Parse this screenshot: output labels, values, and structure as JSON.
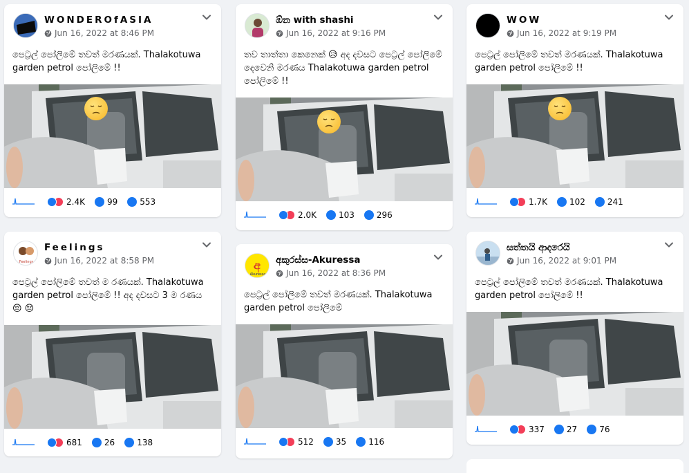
{
  "posts": [
    {
      "page_name": "WONDEROfASIA",
      "date": "Jun 16, 2022 at 8:46 PM",
      "text": "පෙට්‍රල් පෝලිමේ තවත් මරණයක්. Thalakotuwa garden petrol පෝලිමේ !!",
      "reactions": "2.4K",
      "comments": "99",
      "shares": "553",
      "photo_emoji": true
    },
    {
      "page_name": "ඕන with shashi",
      "date": "Jun 16, 2022 at 9:16 PM",
      "text": "තව තාත්තා කෙනෙක් 😥 අද දවසට පෙට්‍රල් පෝලිමේ දෙවෙනි මරණය Thalakotuwa garden petrol පෝලිමේ !!",
      "reactions": "2.0K",
      "comments": "103",
      "shares": "296",
      "photo_emoji": true
    },
    {
      "page_name": "WOW",
      "date": "Jun 16, 2022 at 9:19 PM",
      "text": "පෙට්‍රල් පෝලිමේ තවත් මරණයක්. Thalakotuwa garden petrol පෝලිමේ !!",
      "reactions": "1.7K",
      "comments": "102",
      "shares": "241",
      "photo_emoji": true
    },
    {
      "page_name": "Feelings",
      "date": "Jun 16, 2022 at 8:58 PM",
      "text": "පෙට්‍රල් පෝලිමේ තවත් ම රණයක්. Thalakotuwa garden petrol පෝලිමේ !! අද දවසට 3 ම රණය 😔 😔",
      "reactions": "681",
      "comments": "26",
      "shares": "138",
      "photo_emoji": false
    },
    {
      "page_name": "අකුරස්ස-Akuressa",
      "date": "Jun 16, 2022 at 8:36 PM",
      "text": "පෙට්‍රල් පෝලිමේ තවත් මරණයක්. Thalakotuwa garden petrol පෝලිමේ",
      "reactions": "512",
      "comments": "35",
      "shares": "116",
      "photo_emoji": false
    },
    {
      "page_name": "සත්තයි ආදරෙයි",
      "date": "Jun 16, 2022 at 9:01 PM",
      "text": "පෙට්‍රල් පෝලිමේ තවත් මරණයක්. Thalakotuwa garden petrol පෝලිමේ !!",
      "reactions": "337",
      "comments": "27",
      "shares": "76",
      "photo_emoji": false
    }
  ],
  "avatar_labels": {
    "feelings": "Feelings",
    "akuressa": "Akuressa"
  },
  "colors": {
    "background": "#f0f2f5",
    "card": "#ffffff",
    "accent": "#1877f2",
    "love": "#f33e58",
    "meta_text": "#65676b"
  },
  "icons": [
    "globe-icon",
    "chevron-down-icon",
    "like-icon",
    "love-icon",
    "comment-icon",
    "share-icon",
    "sparkline-icon",
    "sad-face-emoji"
  ]
}
